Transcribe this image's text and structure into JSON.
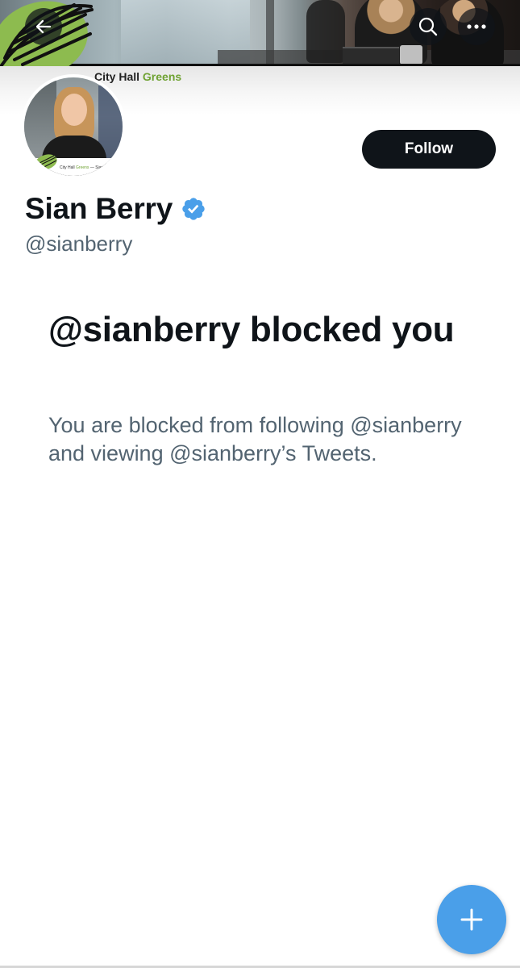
{
  "banner": {
    "logo": {
      "text_main": "City Hall",
      "text_accent": "Greens",
      "accent_color": "#6fa232"
    }
  },
  "icons": {
    "back": "arrow-left-icon",
    "search": "search-icon",
    "more": "more-horizontal-icon",
    "verified": "verified-badge-icon",
    "compose": "plus-icon"
  },
  "avatar": {
    "caption_main": "City Hall",
    "caption_accent": "Greens",
    "caption_suffix": "— Sian"
  },
  "profile": {
    "display_name": "Sian Berry",
    "handle": "@sianberry",
    "verified": true,
    "follow_label": "Follow"
  },
  "blocked": {
    "title": "@sianberry blocked you",
    "description": "You are blocked from following @sianberry and viewing @sianberry’s Tweets."
  },
  "colors": {
    "text_primary": "#0f1419",
    "text_secondary": "#536471",
    "follow_bg": "#0f1419",
    "verified_blue": "#4a9fe9",
    "fab_blue": "#4a9fe9",
    "logo_green": "#8dbb4f"
  }
}
